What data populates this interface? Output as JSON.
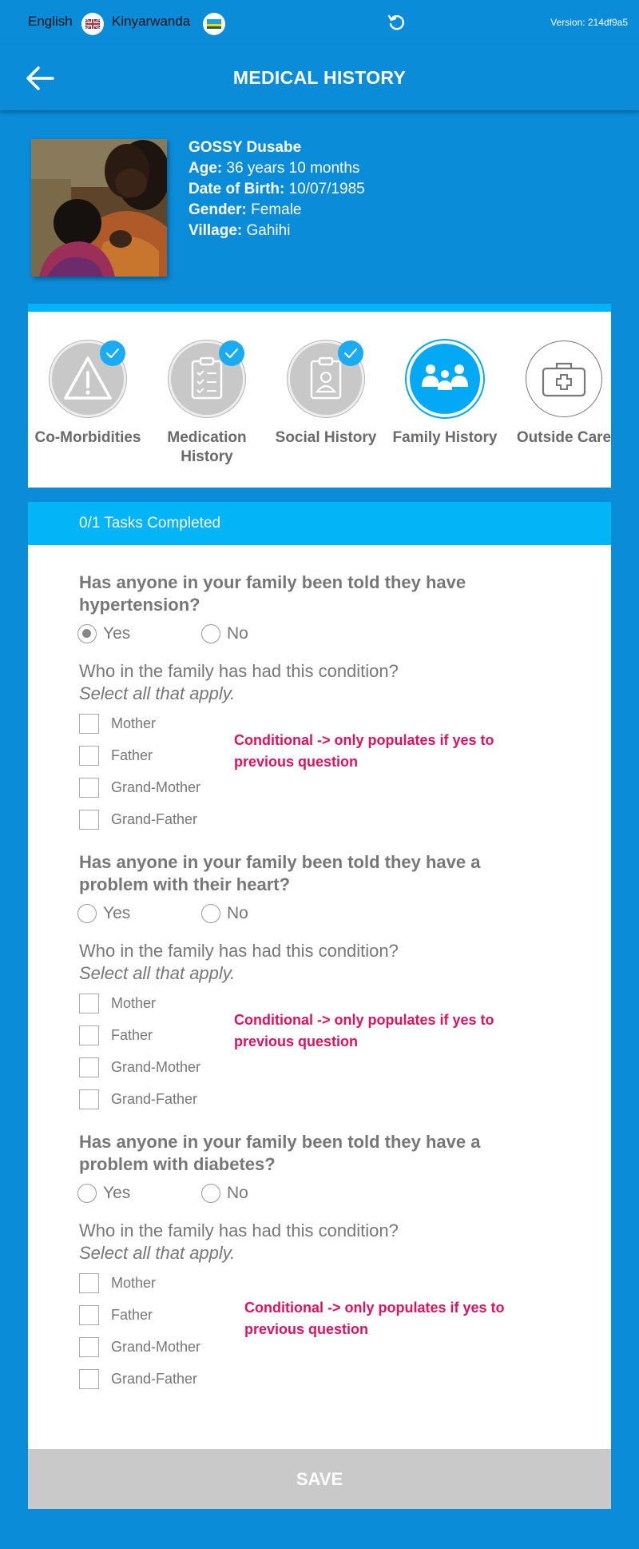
{
  "topbar": {
    "lang_en": "English",
    "lang_rw": "Kinyarwanda",
    "version": "Version: 214df9a5",
    "icons": [
      "uk-flag-icon",
      "rwanda-flag-icon",
      "refresh-icon"
    ]
  },
  "header": {
    "title": "MEDICAL HISTORY",
    "back_icon": "arrow-left-icon"
  },
  "patient": {
    "name": "GOSSY Dusabe",
    "age_label": "Age:",
    "age": "36 years 10 months",
    "dob_label": "Date of Birth:",
    "dob": "10/07/1985",
    "gender_label": "Gender:",
    "gender": "Female",
    "village_label": "Village:",
    "village": "Gahihi"
  },
  "tabs": [
    {
      "label": "Co-Morbidities",
      "icon": "warning-icon",
      "completed": true
    },
    {
      "label": "Medication History",
      "icon": "clipboard-list-icon",
      "completed": true
    },
    {
      "label": "Social History",
      "icon": "clipboard-person-icon",
      "completed": true
    },
    {
      "label": "Family History",
      "icon": "family-icon",
      "active": true
    },
    {
      "label": "Outside Care",
      "icon": "medical-kit-icon",
      "completed": false
    }
  ],
  "tasks": {
    "label": "0/1 Tasks Completed"
  },
  "questions": [
    {
      "text": "Has anyone in your family been told they have hypertension?",
      "yes": "Yes",
      "no": "No",
      "selected": "Yes",
      "sub": "Who in the family has had this condition?",
      "sub_hint": "Select all that apply.",
      "options": [
        "Mother",
        "Father",
        "Grand-Mother",
        "Grand-Father"
      ],
      "note": "Conditional -> only populates if yes to previous question"
    },
    {
      "text": "Has anyone in your family been told they have a problem with their heart?",
      "yes": "Yes",
      "no": "No",
      "selected": "",
      "sub": "Who in the family has had this condition?",
      "sub_hint": "Select all that apply.",
      "options": [
        "Mother",
        "Father",
        "Grand-Mother",
        "Grand-Father"
      ],
      "note": "Conditional -> only populates if yes to previous question"
    },
    {
      "text": "Has anyone in your family been told they have a problem with diabetes?",
      "yes": "Yes",
      "no": "No",
      "selected": "",
      "sub": "Who in the family has had this condition?",
      "sub_hint": "Select all that apply.",
      "options": [
        "Mother",
        "Father",
        "Grand-Mother",
        "Grand-Father"
      ],
      "note": "Conditional -> only populates if yes to previous question"
    }
  ],
  "save_label": "SAVE",
  "colors": {
    "primary": "#0b8cd9",
    "accent": "#03b5f7",
    "note": "#e0115f",
    "save_disabled": "#c9c9c9"
  }
}
